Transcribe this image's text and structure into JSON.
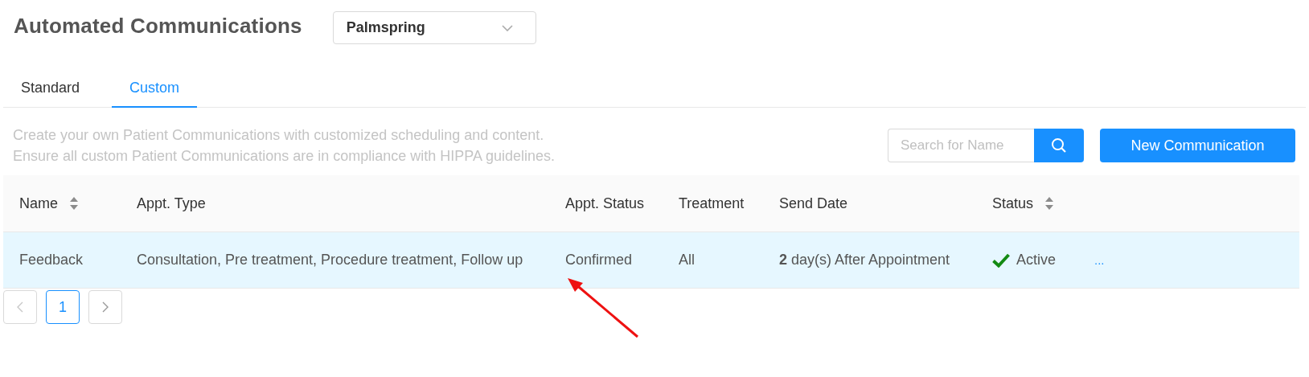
{
  "page_title": "Automated Communications",
  "location_select": {
    "value": "Palmspring"
  },
  "tabs": [
    {
      "label": "Standard",
      "selected": false
    },
    {
      "label": "Custom",
      "selected": true
    }
  ],
  "description": [
    "Create your own Patient Communications with customized scheduling and content.",
    "Ensure all custom Patient Communications are in compliance with HIPPA guidelines."
  ],
  "search": {
    "placeholder": "Search for Name"
  },
  "new_button": "New Communication",
  "table": {
    "columns": [
      {
        "label": "Name",
        "sortable": true
      },
      {
        "label": "Appt. Type",
        "sortable": false
      },
      {
        "label": "Appt. Status",
        "sortable": false
      },
      {
        "label": "Treatment",
        "sortable": false
      },
      {
        "label": "Send Date",
        "sortable": false
      },
      {
        "label": "Status",
        "sortable": true
      }
    ],
    "rows": [
      {
        "name": "Feedback",
        "appt_type": "Consultation, Pre treatment, Procedure treatment, Follow up",
        "appt_status": "Confirmed",
        "treatment": "All",
        "send_date": "**2** day(s) After Appointment",
        "status": {
          "kind": "active",
          "label": "Active"
        },
        "more": "...",
        "selected": true
      }
    ]
  },
  "pagination": {
    "prev_disabled": true,
    "pages": [
      {
        "label": "1",
        "selected": true
      }
    ],
    "next_disabled": false
  },
  "annotation": {
    "kind": "arrow"
  }
}
